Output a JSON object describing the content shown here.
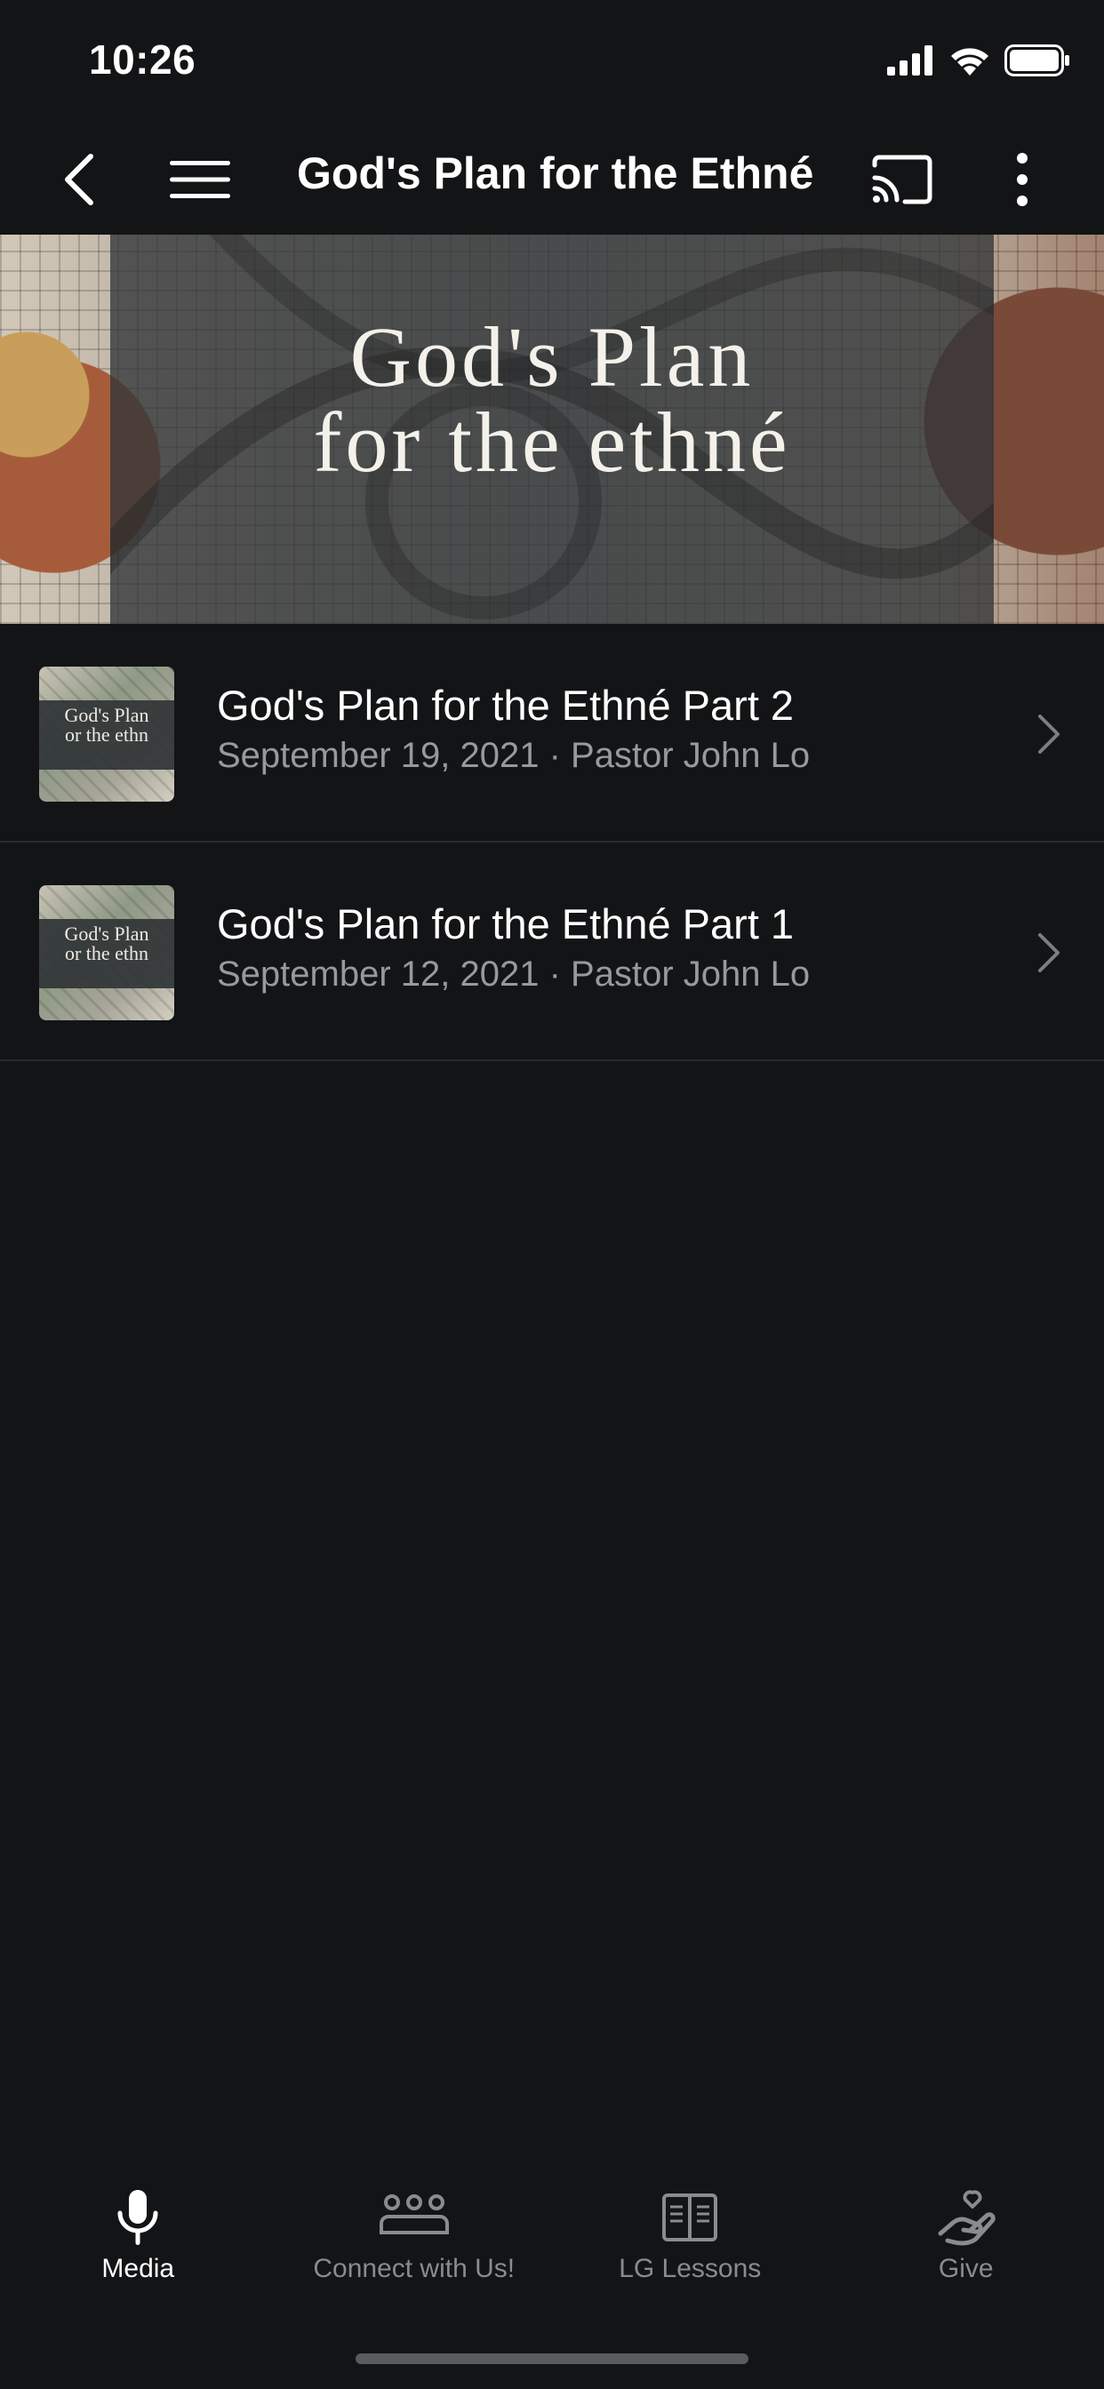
{
  "status_bar": {
    "time": "10:26"
  },
  "nav": {
    "title": "God's Plan for the Ethné",
    "back_icon": "chevron-left-icon",
    "menu_icon": "hamburger-icon",
    "cast_icon": "cast-icon",
    "more_icon": "more-vertical-icon"
  },
  "banner": {
    "line1": "God's Plan",
    "line2": "for the ethné"
  },
  "series_items": [
    {
      "thumb_text_1": "God's Plan",
      "thumb_text_2": "or the ethn",
      "title": "God's Plan for the Ethné Part 2",
      "subtitle": "September 19, 2021 · Pastor John Lo"
    },
    {
      "thumb_text_1": "God's Plan",
      "thumb_text_2": "or the ethn",
      "title": "God's Plan for the Ethné Part 1",
      "subtitle": "September 12, 2021 · Pastor John Lo"
    }
  ],
  "tabs": [
    {
      "label": "Media",
      "icon": "microphone-icon",
      "active": true
    },
    {
      "label": "Connect with Us!",
      "icon": "people-group-icon",
      "active": false
    },
    {
      "label": "LG Lessons",
      "icon": "open-book-icon",
      "active": false
    },
    {
      "label": "Give",
      "icon": "hand-heart-icon",
      "active": false
    }
  ],
  "colors": {
    "background": "#131416",
    "text_primary": "#ffffff",
    "text_secondary": "#98999c",
    "tab_inactive": "#8a8b8e"
  }
}
